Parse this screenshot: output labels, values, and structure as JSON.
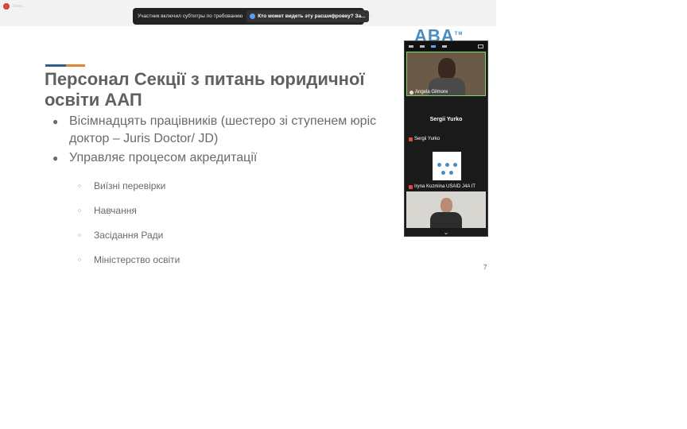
{
  "recording": {
    "label": "Запис..."
  },
  "caption_banner": {
    "message": "Участник включил субтитры по требованию",
    "who_can_see": "Кто может видеть эту расшифровку? За...",
    "close_symbol": "×"
  },
  "slide": {
    "title": "Персонал Секції з питань юридичної освіти ААП",
    "bullets": [
      "Вісімнадцять працівників (шестеро зі ступенем юріс доктор – Juris Doctor/ JD)",
      "Управляє процесом акредитації"
    ],
    "sub_bullets": [
      "Виїзні перевірки",
      "Навчання",
      "Засідання Ради",
      "Міністерство освіти"
    ],
    "bullet_symbol": "●",
    "sub_bullet_symbol": "○",
    "page_number": "7",
    "logo_text": "ABA",
    "logo_tm": "TM",
    "accent_colors": [
      "#2b5f8e",
      "#e5832e"
    ]
  },
  "participants": {
    "tiles": [
      {
        "name": "Angela Gilmore",
        "icon": "pin-icon"
      },
      {
        "name": "Sergii Yurko",
        "display_name": "Sergii Yurko",
        "icon": "mic-muted-icon"
      },
      {
        "name": "Iryna Kuzmina USAID J4A IT",
        "icon": "mic-muted-icon"
      },
      {
        "name": "",
        "icon": ""
      }
    ],
    "scroll_symbol": "⌄"
  }
}
